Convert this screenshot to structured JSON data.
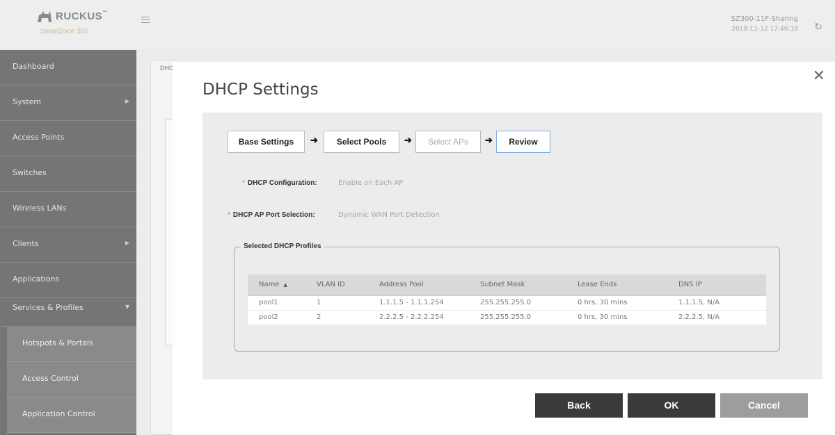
{
  "header": {
    "logo_text": "RUCKUS",
    "logo_tm": "™",
    "logo_sub": "SmartZone 300",
    "host": "SZ300-11F-Sharing",
    "datetime": "2018-11-12 17:46:18"
  },
  "sidebar": {
    "items": [
      {
        "label": "Dashboard"
      },
      {
        "label": "System"
      },
      {
        "label": "Access Points"
      },
      {
        "label": "Switches"
      },
      {
        "label": "Wireless LANs"
      },
      {
        "label": "Clients"
      },
      {
        "label": "Applications"
      },
      {
        "label": "Services & Profiles"
      }
    ],
    "subitems": [
      {
        "label": "Hotspots & Portals"
      },
      {
        "label": "Access Control"
      },
      {
        "label": "Application Control"
      }
    ]
  },
  "background": {
    "tab_label": "DHC"
  },
  "modal": {
    "title": "DHCP Settings",
    "steps": [
      {
        "label": "Base Settings"
      },
      {
        "label": "Select Pools"
      },
      {
        "label": "Select APs"
      },
      {
        "label": "Review"
      }
    ],
    "fields": {
      "dhcp_config_label": "DHCP Configuration:",
      "dhcp_config_value": "Enable on Each AP",
      "port_selection_label": "DHCP AP Port Selection:",
      "port_selection_value": "Dynamic WAN Port Detection"
    },
    "profiles_legend": "Selected DHCP Profiles",
    "table": {
      "columns": [
        "Name",
        "VLAN ID",
        "Address Pool",
        "Subnet Mask",
        "Lease Ends",
        "DNS IP"
      ],
      "rows": [
        [
          "pool1",
          "1",
          "1.1.1.5 - 1.1.1.254",
          "255.255.255.0",
          "0 hrs, 30 mins",
          "1.1.1.5, N/A"
        ],
        [
          "pool2",
          "2",
          "2.2.2.5 - 2.2.2.254",
          "255.255.255.0",
          "0 hrs, 30 mins",
          "2.2.2.5, N/A"
        ]
      ]
    },
    "buttons": {
      "back": "Back",
      "ok": "OK",
      "cancel": "Cancel"
    }
  }
}
